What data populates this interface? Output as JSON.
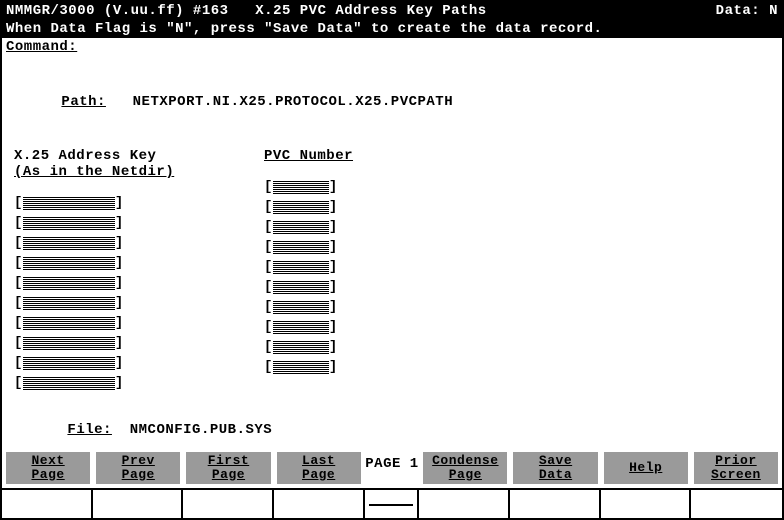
{
  "title": {
    "app": "NMMGR/3000 (V.uu.ff) #163",
    "screen": "X.25 PVC Address Key Paths",
    "data_label": "Data:",
    "data_flag": "N"
  },
  "hint": "When Data Flag is \"N\", press \"Save Data\" to create the data record.",
  "command_label": "Command:",
  "command_value": "",
  "path_label": "Path:",
  "path_value": "NETXPORT.NI.X25.PROTOCOL.X25.PVCPATH",
  "columns": {
    "addr_hdr1": "X.25 Address Key",
    "addr_hdr2": "(As in the Netdir)",
    "pvc_hdr1": "",
    "pvc_hdr2": "PVC Number"
  },
  "rows": [
    {
      "addr": "",
      "pvc": ""
    },
    {
      "addr": "",
      "pvc": ""
    },
    {
      "addr": "",
      "pvc": ""
    },
    {
      "addr": "",
      "pvc": ""
    },
    {
      "addr": "",
      "pvc": ""
    },
    {
      "addr": "",
      "pvc": ""
    },
    {
      "addr": "",
      "pvc": ""
    },
    {
      "addr": "",
      "pvc": ""
    },
    {
      "addr": "",
      "pvc": ""
    },
    {
      "addr": "",
      "pvc": ""
    }
  ],
  "file_label": "File:",
  "file_value": "NMCONFIG.PUB.SYS",
  "page_indicator": "PAGE 1",
  "fkeys": {
    "f1a": "Next",
    "f1b": "Page",
    "f2a": "Prev",
    "f2b": "Page",
    "f3a": "First",
    "f3b": "Page",
    "f4a": "Last",
    "f4b": "Page",
    "f5a": "Condense",
    "f5b": "Page",
    "f6a": "Save",
    "f6b": "Data",
    "f7a": "Help",
    "f7b": "",
    "f8a": "Prior",
    "f8b": "Screen"
  }
}
